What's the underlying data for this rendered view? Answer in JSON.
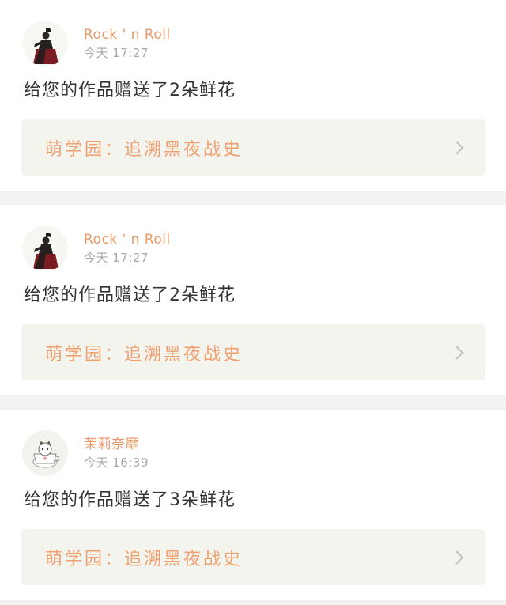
{
  "colors": {
    "username": "#e89a6b",
    "time": "#a8a8a8",
    "message": "#333333",
    "work_title": "#f0a070",
    "work_bg": "#f4f4ee",
    "page_bg": "#f2f2f2"
  },
  "notifications": [
    {
      "username": "Rock ' n Roll",
      "time": "今天 17:27",
      "message": "给您的作品赠送了2朵鲜花",
      "work": "萌学园：追溯黑夜战史",
      "avatar_icon": "dark-figure-avatar-icon"
    },
    {
      "username": "Rock ' n Roll",
      "time": "今天 17:27",
      "message": "给您的作品赠送了2朵鲜花",
      "work": "萌学园：追溯黑夜战史",
      "avatar_icon": "dark-figure-avatar-icon"
    },
    {
      "username": "茉莉奈靡",
      "time": "今天 16:39",
      "message": "给您的作品赠送了3朵鲜花",
      "work": "萌学园：追溯黑夜战史",
      "avatar_icon": "teacup-cat-avatar-icon"
    }
  ]
}
